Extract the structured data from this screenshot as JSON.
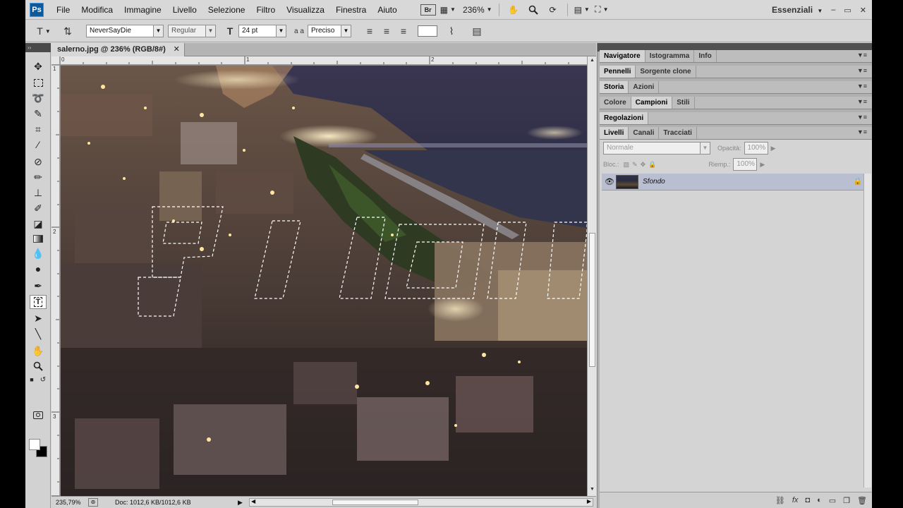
{
  "menubar": {
    "logo": "Ps",
    "items": [
      "File",
      "Modifica",
      "Immagine",
      "Livello",
      "Selezione",
      "Filtro",
      "Visualizza",
      "Finestra",
      "Aiuto"
    ],
    "zoom": "236%",
    "workspace": "Essenziali",
    "win_controls": [
      "–",
      "▭",
      "✕"
    ]
  },
  "options": {
    "font_family": "NeverSayDie",
    "font_style": "Regular",
    "font_size": "24 pt",
    "aa_label": "a a",
    "antialias": "Preciso",
    "tool_icon": "type-mask-icon"
  },
  "document": {
    "tab_title": "salerno.jpg @ 236% (RGB/8#)",
    "tab_close": "✕",
    "ruler_h": [
      "0",
      "1",
      "2"
    ],
    "ruler_v": [
      "1",
      "2",
      "3"
    ],
    "selection_text": "PIOTTI",
    "status_zoom": "235,79%",
    "status_doc": "Doc: 1012,6 KB/1012,6 KB"
  },
  "panels": {
    "group1": [
      "Navigatore",
      "Istogramma",
      "Info"
    ],
    "group2": [
      "Pennelli",
      "Sorgente clone"
    ],
    "group3": [
      "Storia",
      "Azioni"
    ],
    "group4": [
      "Colore",
      "Campioni",
      "Stili"
    ],
    "group5": [
      "Regolazioni"
    ],
    "group6": [
      "Livelli",
      "Canali",
      "Tracciati"
    ],
    "layers": {
      "blend_mode": "Normale",
      "opacity_label": "Opacità:",
      "opacity": "100%",
      "lock_label": "Bloc.:",
      "fill_label": "Riemp.:",
      "fill": "100%",
      "layer_name": "Sfondo"
    }
  },
  "colors": {
    "fg": "#ffffff",
    "bg": "#000000",
    "accent": "#0c5a9c"
  }
}
